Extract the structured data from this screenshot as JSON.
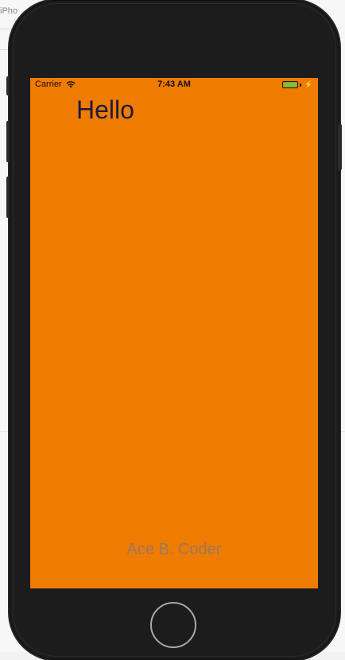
{
  "device": {
    "backdrop_tab_text": "iPho"
  },
  "status_bar": {
    "carrier": "Carrier",
    "time": "7:43 AM",
    "battery_level": 1.0,
    "wifi_icon": "wifi-icon",
    "charging_icon": "charging-bolt-icon"
  },
  "app": {
    "background_color": "#ef7b00",
    "hello_label": "Hello",
    "author_label": "Ace B. Coder"
  },
  "controls": {
    "home_button_icon": "home-button-icon"
  }
}
